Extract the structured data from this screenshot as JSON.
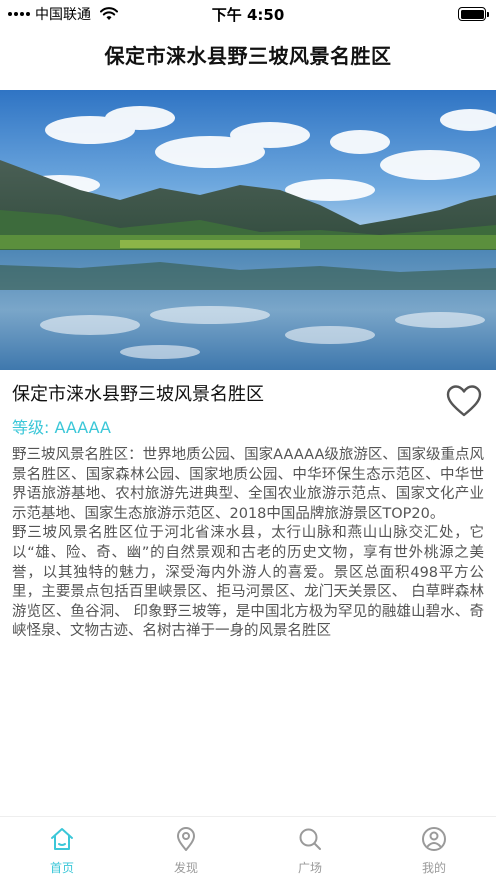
{
  "status_bar": {
    "carrier": "中国联通",
    "time": "下午 4:50"
  },
  "header": {
    "title": "保定市涞水县野三坡风景名胜区"
  },
  "scenic": {
    "name": "保定市涞水县野三坡风景名胜区",
    "level": "等级: AAAAA",
    "description": [
      "野三坡风景名胜区：世界地质公园、国家AAAAA级旅游区、国家级重点风景名胜区、国家森林公园、国家地质公园、中华环保生态示范区、中华世界语旅游基地、农村旅游先进典型、全国农业旅游示范点、国家文化产业示范基地、国家生态旅游示范区、2018中国品牌旅游景区TOP20。",
      "野三坡风景名胜区位于河北省涞水县，太行山脉和燕山山脉交汇处，它以“雄、险、奇、幽”的自然景观和古老的历史文物，享有世外桃源之美誉，以其独特的魅力，深受海内外游人的喜爱。景区总面积498平方公里，主要景点包括百里峡景区、拒马河景区、龙门天关景区、 白草畔森林游览区、鱼谷洞、 印象野三坡等，是中国北方极为罕见的融雄山碧水、奇峡怪泉、文物古迹、名树古禅于一身的风景名胜区"
    ]
  },
  "tabbar": {
    "tabs": [
      {
        "label": "首页",
        "icon": "home-icon",
        "active": true
      },
      {
        "label": "发现",
        "icon": "location-pin-icon",
        "active": false
      },
      {
        "label": "广场",
        "icon": "search-icon",
        "active": false
      },
      {
        "label": "我的",
        "icon": "user-icon",
        "active": false
      }
    ]
  },
  "colors": {
    "accent": "#3bc7d8",
    "inactive": "#9a9a9a",
    "text": "#555555"
  }
}
